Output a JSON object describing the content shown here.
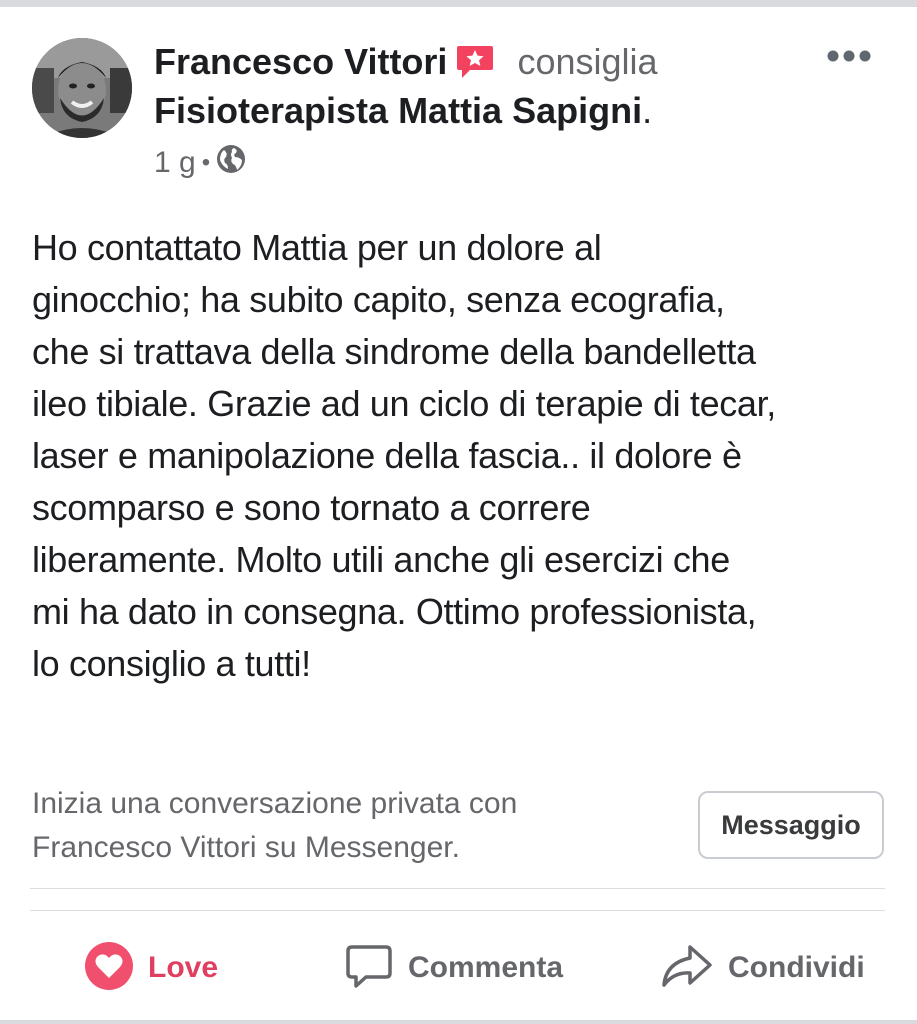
{
  "post": {
    "author_name": "Francesco Vittori",
    "recommend_verb": "consiglia",
    "page_name": "Fisioterapista Mattia Sapigni",
    "page_name_suffix": ".",
    "time_ago": "1 g",
    "meta_separator": "•",
    "audience_icon": "globe-icon",
    "badge_icon": "recommendation-star-icon",
    "more_icon": "more-options-icon",
    "body_lines": [
      "Ho contattato Mattia per un dolore al",
      "ginocchio; ha subito capito, senza ecografia,",
      "che si trattava della sindrome della bandelletta",
      "ileo tibiale. Grazie ad un ciclo di terapie di tecar,",
      "laser e manipolazione della fascia.. il dolore è",
      "scomparso e sono tornato a correre",
      "liberamente. Molto utili anche gli esercizi che",
      "mi ha dato in consegna. Ottimo professionista,",
      "lo consiglio a tutti!"
    ]
  },
  "messenger_prompt": {
    "line1": "Inizia una conversazione privata con",
    "line2": "Francesco Vittori su Messenger.",
    "button_label": "Messaggio"
  },
  "actions": {
    "love": {
      "label": "Love",
      "icon": "heart-reaction-icon",
      "color": "#e0405f"
    },
    "comment": {
      "label": "Commenta",
      "icon": "comment-bubble-icon"
    },
    "share": {
      "label": "Condividi",
      "icon": "share-arrow-icon"
    }
  },
  "colors": {
    "primary_text": "#1c1e21",
    "secondary_text": "#65676b",
    "badge": "#f3425f",
    "love": "#e0405f",
    "divider": "#dadde1"
  }
}
